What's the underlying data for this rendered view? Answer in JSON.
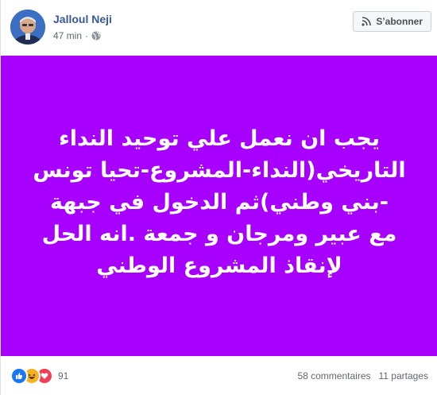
{
  "post": {
    "author": "Jalloul Neji",
    "time": "47 min",
    "time_separator": "·",
    "follow_label": "S’abonner",
    "text": "يجب ان نعمل علي توحيد النداء التاريخي(النداء-المشروع-تحيا تونس -بني وطني)ثم الدخول في جبهة مع عبير ومرجان و جمعة .انه الحل لإنقاذ المشروع الوطني",
    "background_color": "#a800ff"
  },
  "footer": {
    "reactions": [
      "like-icon",
      "haha-icon",
      "love-icon"
    ],
    "reaction_count": "91",
    "comments": "58 commentaires",
    "shares": "11 partages"
  }
}
